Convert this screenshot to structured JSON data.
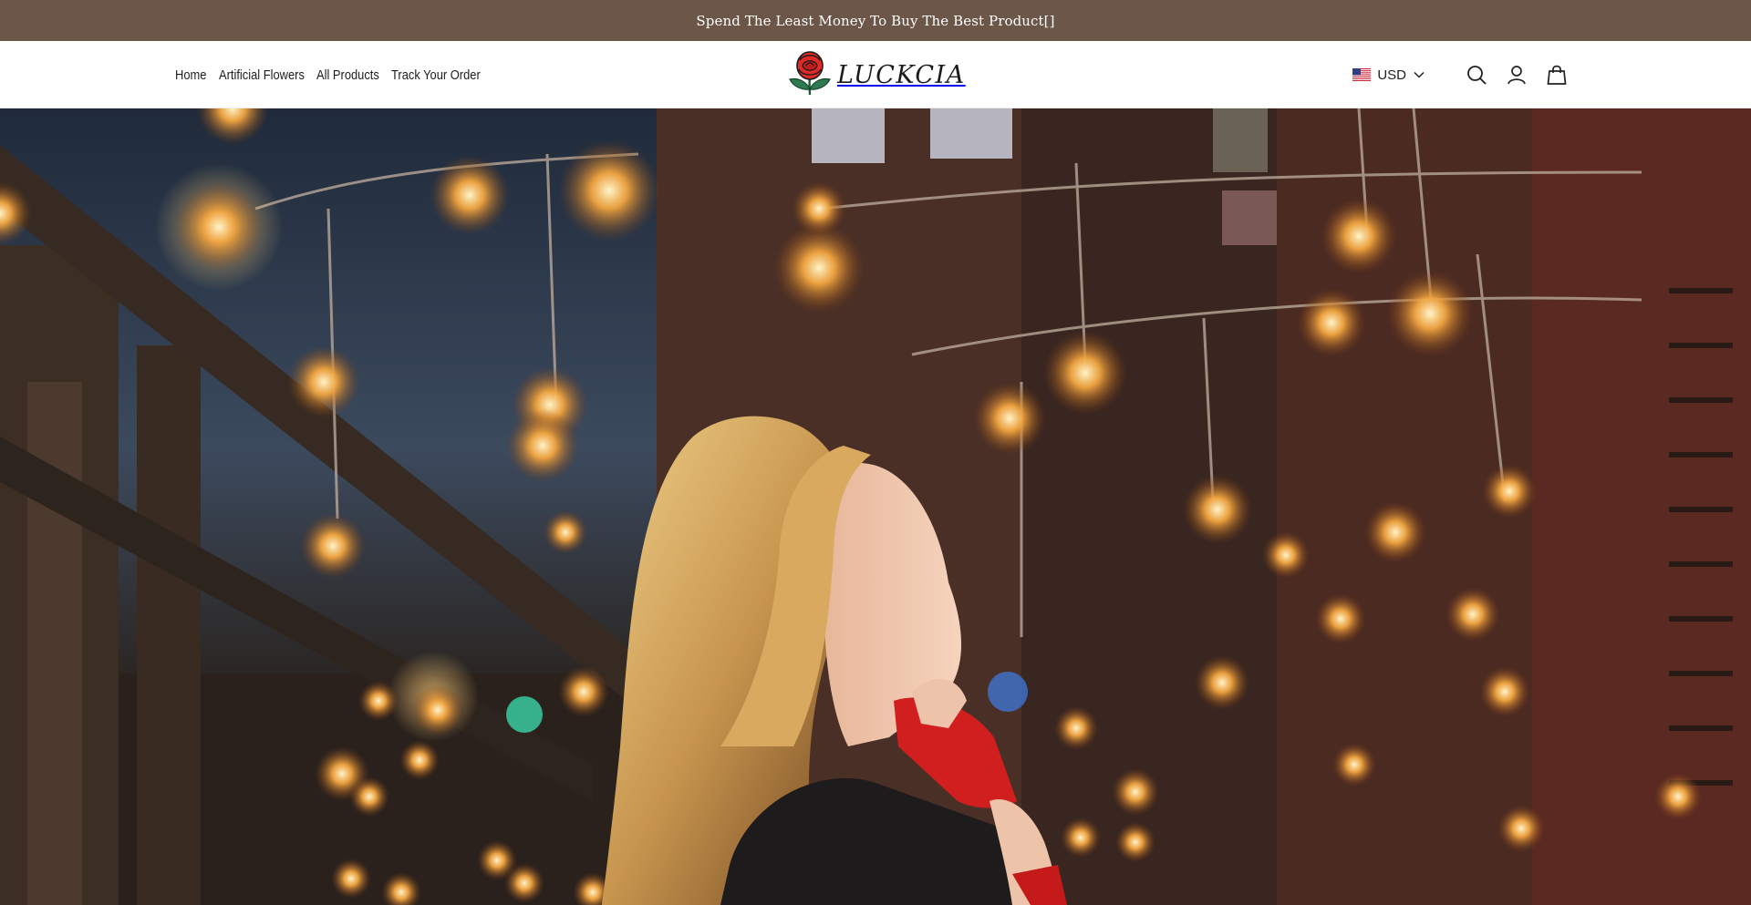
{
  "announcement": {
    "text": "Spend The Least Money To Buy The Best Product[]"
  },
  "nav": {
    "items": [
      {
        "label": "Home"
      },
      {
        "label": "Artificial Flowers"
      },
      {
        "label": "All Products"
      },
      {
        "label": "Track Your Order"
      }
    ]
  },
  "logo": {
    "text": "LUCKCIA",
    "icon": "rose-icon"
  },
  "currency": {
    "label": "USD",
    "flag": "us-flag-icon"
  },
  "icons": {
    "search": "search-icon",
    "account": "user-icon",
    "cart": "bag-icon"
  },
  "colors": {
    "announcement_bg": "#6b5648",
    "header_bg": "#ffffff",
    "accent": "#e02a2a"
  },
  "hero": {
    "image": "woman-looking-up-at-hanging-lanterns"
  }
}
